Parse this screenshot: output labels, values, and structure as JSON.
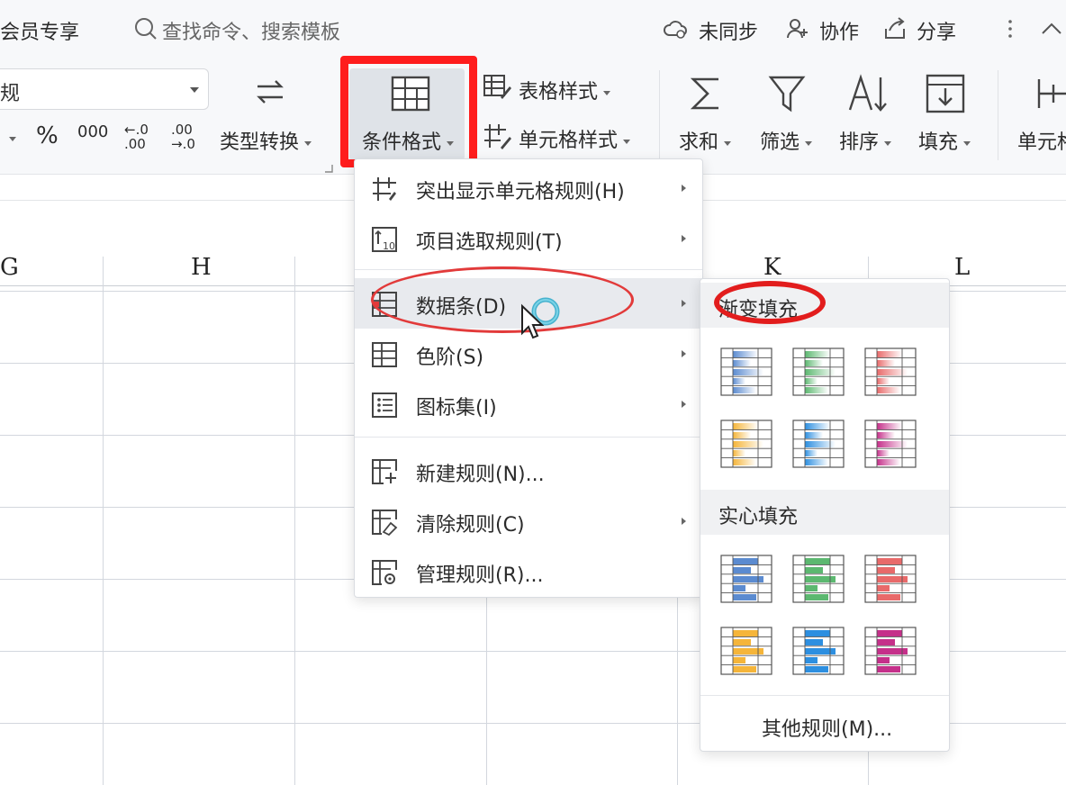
{
  "topbar": {
    "member_label": "会员专享",
    "search_placeholder": "查找命令、搜索模板",
    "sync_label": "未同步",
    "collab_label": "协作",
    "share_label": "分享"
  },
  "ribbon": {
    "number_format_value": "规",
    "percent_symbol": "%",
    "thousands_symbol": "000",
    "dec_increase": "←.0 .00",
    "dec_decrease": ".00 →.0",
    "type_convert": "类型转换",
    "conditional_format": "条件格式",
    "table_style": "表格样式",
    "cell_style": "单元格样式",
    "sum": "求和",
    "filter": "筛选",
    "sort": "排序",
    "fill": "填充",
    "cell": "单元格"
  },
  "sheet": {
    "columns": [
      "G",
      "H",
      "K",
      "L"
    ]
  },
  "menu": {
    "items": [
      {
        "label": "突出显示单元格规则(H)",
        "has_submenu": true,
        "icon": "highlight-rules-icon"
      },
      {
        "label": "项目选取规则(T)",
        "has_submenu": true,
        "icon": "top-rules-icon"
      },
      {
        "label": "数据条(D)",
        "has_submenu": true,
        "icon": "data-bar-icon",
        "highlighted": true
      },
      {
        "label": "色阶(S)",
        "has_submenu": true,
        "icon": "color-scale-icon"
      },
      {
        "label": "图标集(I)",
        "has_submenu": true,
        "icon": "icon-set-icon"
      },
      {
        "label": "新建规则(N)...",
        "has_submenu": false,
        "icon": "new-rule-icon"
      },
      {
        "label": "清除规则(C)",
        "has_submenu": true,
        "icon": "clear-rule-icon"
      },
      {
        "label": "管理规则(R)...",
        "has_submenu": false,
        "icon": "manage-rule-icon"
      }
    ]
  },
  "submenu": {
    "gradient_title": "渐变填充",
    "solid_title": "实心填充",
    "other_rules": "其他规则(M)...",
    "gradient_colors": [
      "#5b8bd0",
      "#5cb870",
      "#e86a6a",
      "#f5b53a",
      "#2d8fe0",
      "#c5308a"
    ],
    "solid_colors": [
      "#5b8bd0",
      "#5cb870",
      "#e86a6a",
      "#f5b53a",
      "#2d8fe0",
      "#c5308a"
    ]
  },
  "accent": {
    "annotation_red": "#ff1d1d"
  }
}
